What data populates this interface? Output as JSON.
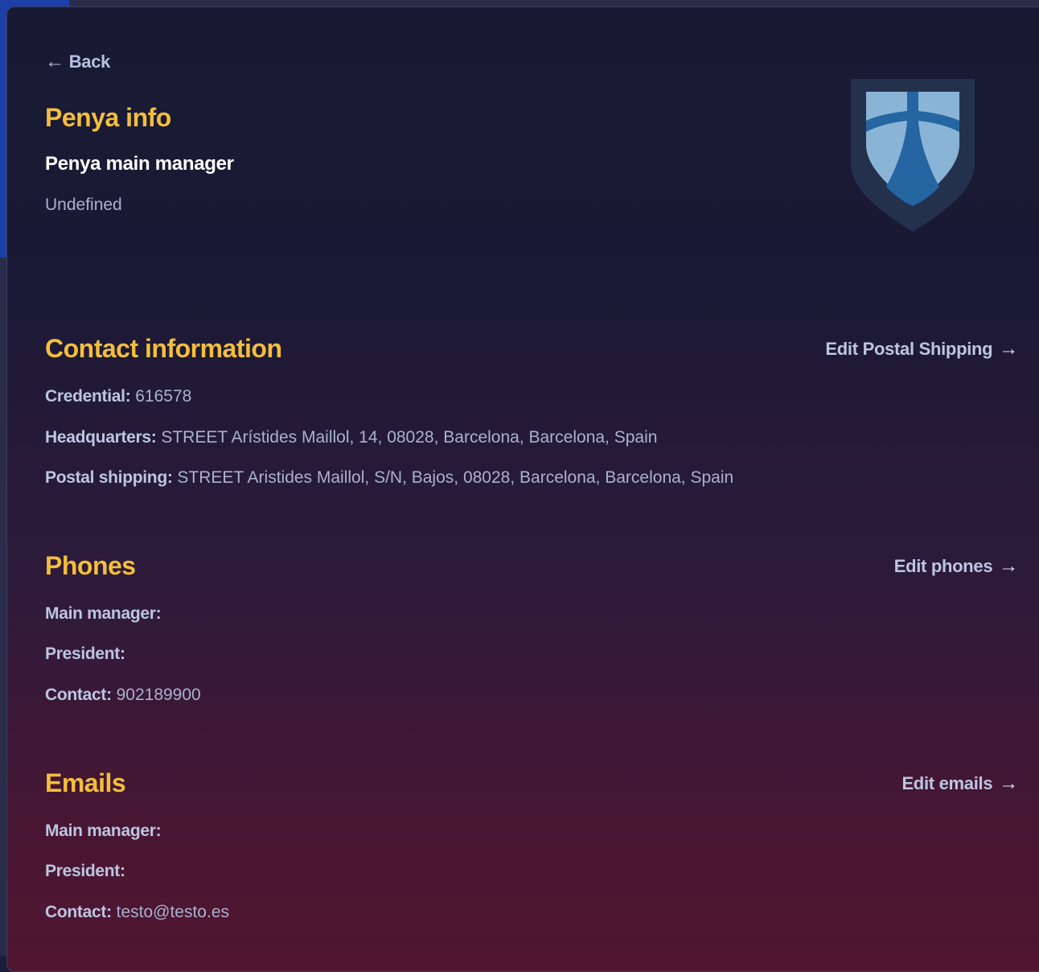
{
  "nav": {
    "back_arrow": "←",
    "back_label": "Back"
  },
  "penya_info": {
    "title": "Penya info",
    "manager_heading": "Penya main manager",
    "manager_value": "Undefined",
    "crest_icon": "club-crest-icon"
  },
  "contact": {
    "title": "Contact information",
    "edit_label": "Edit Postal Shipping",
    "rows": [
      {
        "label": "Credential:",
        "value": "616578"
      },
      {
        "label": "Headquarters:",
        "value": "STREET Arístides Maillol, 14, 08028, Barcelona, Barcelona, Spain"
      },
      {
        "label": "Postal shipping:",
        "value": "STREET Aristides Maillol, S/N, Bajos, 08028, Barcelona, Barcelona, Spain"
      }
    ]
  },
  "phones": {
    "title": "Phones",
    "edit_label": "Edit phones",
    "rows": [
      {
        "label": "Main manager:",
        "value": ""
      },
      {
        "label": "President:",
        "value": ""
      },
      {
        "label": "Contact:",
        "value": "902189900"
      }
    ]
  },
  "emails": {
    "title": "Emails",
    "edit_label": "Edit emails",
    "rows": [
      {
        "label": "Main manager:",
        "value": ""
      },
      {
        "label": "President:",
        "value": ""
      },
      {
        "label": "Contact:",
        "value": "testo@testo.es"
      }
    ]
  },
  "arrow_right": "→",
  "colors": {
    "accent": "#f3be3c",
    "text": "#a9b2cf",
    "label": "#bcc5e2"
  }
}
